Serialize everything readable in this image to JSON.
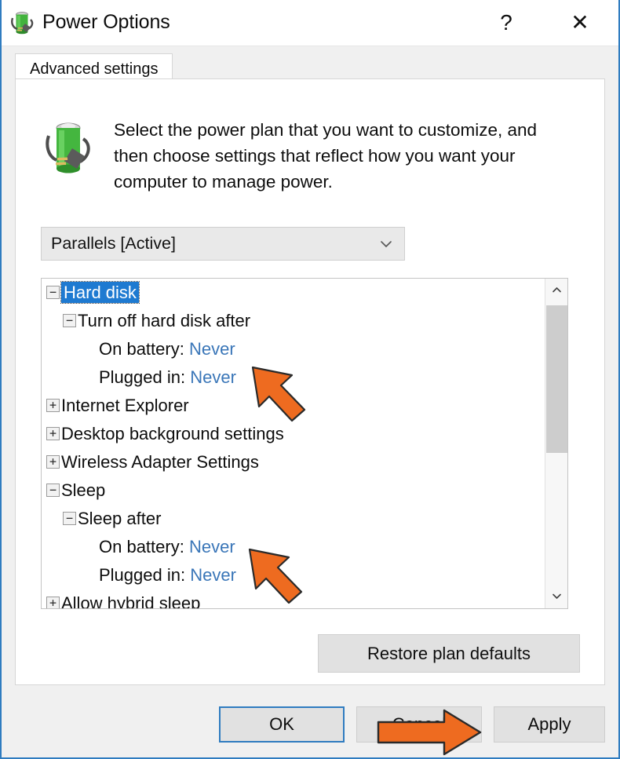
{
  "window": {
    "title": "Power Options",
    "icon": "battery-plug-icon",
    "border_color": "#2f7cc0",
    "caption_buttons": [
      {
        "name": "help-button",
        "glyph": "?"
      },
      {
        "name": "close-button",
        "glyph": "✕"
      }
    ]
  },
  "tabs": [
    {
      "label": "Advanced settings",
      "selected": true
    }
  ],
  "header": {
    "icon": "battery-plug-icon",
    "text": "Select the power plan that you want to customize, and then choose settings that reflect how you want your computer to manage power."
  },
  "plan_combo": {
    "value": "Parallels [Active]",
    "arrow_icon": "chevron-down-icon"
  },
  "tree": {
    "selected_item": "Hard disk",
    "scrollbar": {
      "up_icon": "chevron-up-icon",
      "down_icon": "chevron-down-icon",
      "thumb_color": "#cdcdcd"
    },
    "rows": [
      {
        "level": 0,
        "toggle": "−",
        "label": "Hard disk",
        "selected": true
      },
      {
        "level": 1,
        "toggle": "−",
        "label": "Turn off hard disk after"
      },
      {
        "level": 2,
        "toggle": "",
        "label": "On battery:",
        "value": "Never"
      },
      {
        "level": 2,
        "toggle": "",
        "label": "Plugged in:",
        "value": "Never"
      },
      {
        "level": 0,
        "toggle": "+",
        "label": "Internet Explorer"
      },
      {
        "level": 0,
        "toggle": "+",
        "label": "Desktop background settings"
      },
      {
        "level": 0,
        "toggle": "+",
        "label": "Wireless Adapter Settings"
      },
      {
        "level": 0,
        "toggle": "−",
        "label": "Sleep"
      },
      {
        "level": 1,
        "toggle": "−",
        "label": "Sleep after"
      },
      {
        "level": 2,
        "toggle": "",
        "label": "On battery:",
        "value": "Never"
      },
      {
        "level": 2,
        "toggle": "",
        "label": "Plugged in:",
        "value": "Never"
      },
      {
        "level": 0,
        "toggle": "+",
        "label": "Allow hybrid sleep"
      }
    ]
  },
  "buttons": {
    "restore": "Restore plan defaults",
    "ok": "OK",
    "cancel": "Cancel",
    "apply": "Apply"
  },
  "annotations": {
    "arrow_color": "#ee6b20",
    "arrows": [
      {
        "name": "annotation-arrow-hard-disk-plugged-in",
        "direction": "up-left"
      },
      {
        "name": "annotation-arrow-sleep-plugged-in",
        "direction": "up-left"
      },
      {
        "name": "annotation-arrow-apply",
        "direction": "right"
      }
    ]
  },
  "colors": {
    "selection_blue": "#1e7ad1",
    "value_blue": "#3a76b8",
    "accent": "#2f7cc0",
    "button_face": "#e1e1e1",
    "dialog_face": "#f0f0f0"
  }
}
